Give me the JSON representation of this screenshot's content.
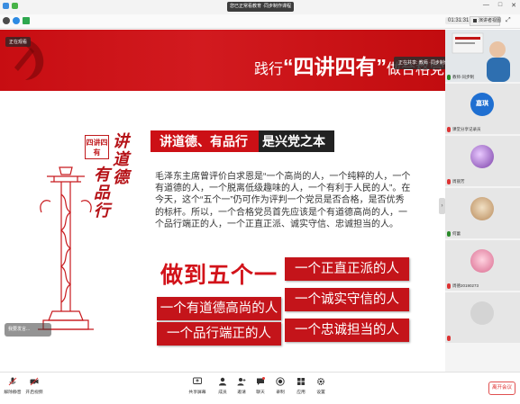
{
  "window": {
    "title": "您已正常看教育 ·同步制作课程",
    "controls": [
      "—",
      "□",
      "✕"
    ]
  },
  "infobar": {
    "timer": "01:31:31",
    "view_label": "演讲者视图"
  },
  "slide": {
    "viewer_tag": "正在观看",
    "banner_prefix": "践行",
    "banner_highlight": "“四讲四有”",
    "banner_suffix": "做合格党员",
    "stamp_text": "四讲四有",
    "calligraphy_1": "讲道德",
    "calligraphy_2": "有品行",
    "heading_red": "讲道德、有品行",
    "heading_black": "是兴党之本",
    "paragraph": "毛泽东主席曾评价白求恩是“一个高尚的人，一个纯粹的人，一个有道德的人，一个脱离低级趣味的人，一个有利于人民的人”。在今天，这个“五个一”仍可作为评判一个党员是否合格，是否优秀的标杆。所以，一个合格党员首先应该是个有道德高尚的人，一个品行端正的人，一个正直正派、诚实守信、忠诚担当的人。",
    "big_title": "做到五个一",
    "pills": [
      "一个正直正派的人",
      "一个有道德高尚的人",
      "一个诚实守信的人",
      "一个品行端正的人",
      "一个忠诚担当的人"
    ],
    "subtitle_bar": "我要发言..."
  },
  "screen_share_tag": "正在共享: 教师 ·同步制作",
  "participants": [
    {
      "name": "教师·同步制",
      "avatar_text": "",
      "mic": "on"
    },
    {
      "name": "课堂分享记录员",
      "avatar_text": "嘉琪",
      "mic": "off"
    },
    {
      "name": "周丽芳",
      "avatar_text": "",
      "mic": "off"
    },
    {
      "name": "何蕾",
      "avatar_text": "",
      "mic": "on"
    },
    {
      "name": "周德20190273",
      "avatar_text": "",
      "mic": "off"
    },
    {
      "name": "",
      "avatar_text": "",
      "mic": "off"
    }
  ],
  "toolbar": {
    "items": [
      "解除静音",
      "开启视频",
      "共享屏幕",
      "成员",
      "邀请",
      "聊天",
      "录制",
      "应用",
      "设置"
    ],
    "end_label": "离开会议"
  },
  "colors": {
    "brand_red": "#c4141a",
    "dark": "#222222"
  }
}
